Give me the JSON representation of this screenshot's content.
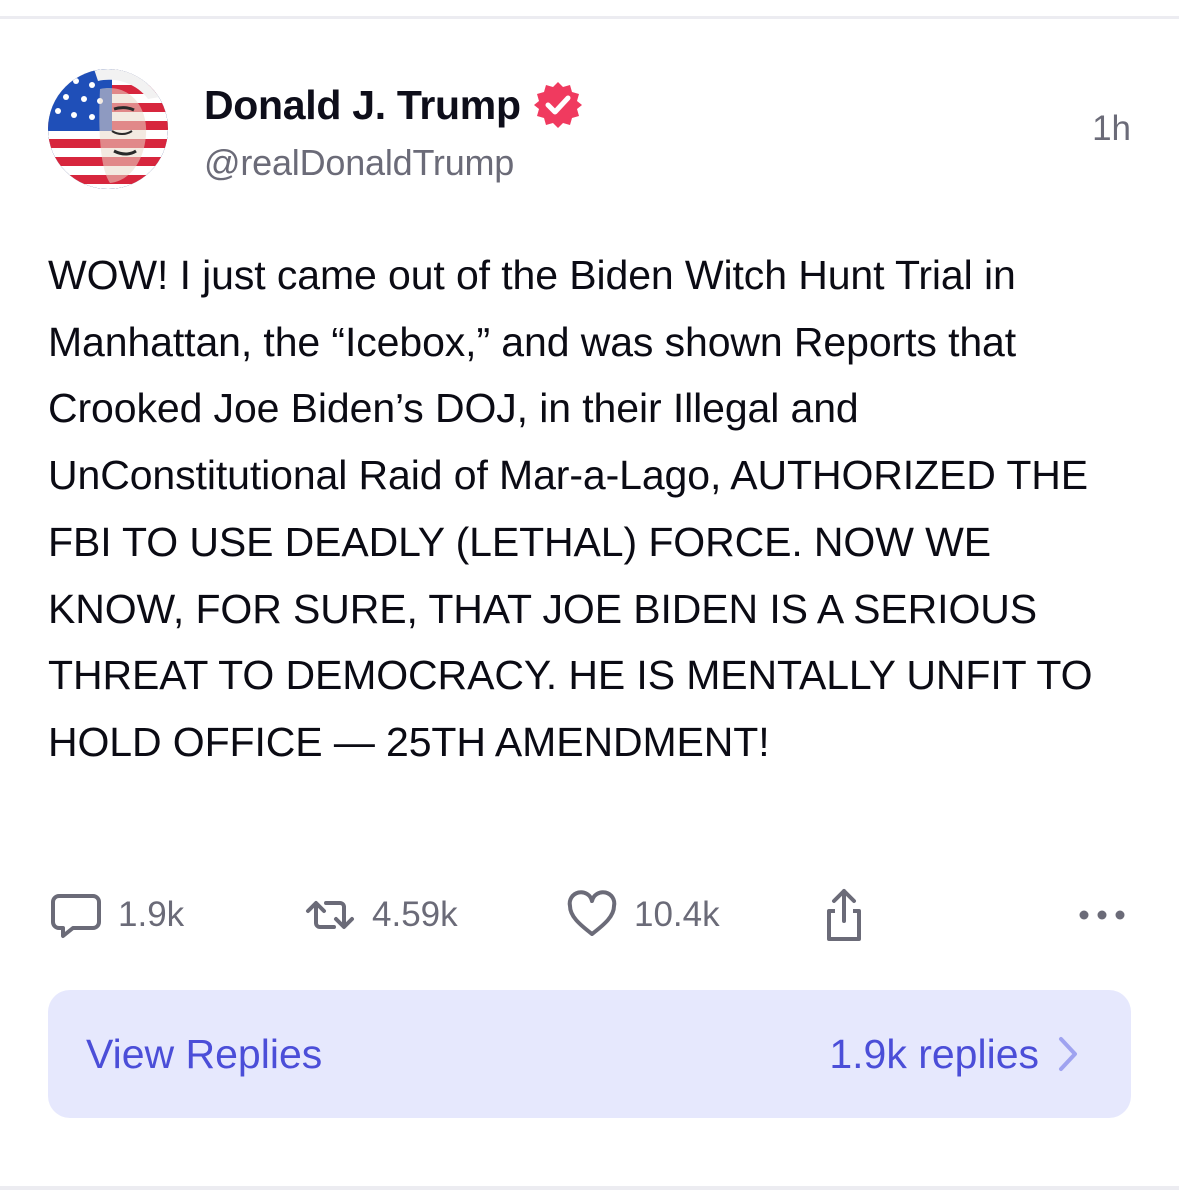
{
  "post": {
    "author": {
      "display_name": "Donald J. Trump",
      "handle": "@realDonaldTrump",
      "verified": true,
      "verified_color": "#f03a5f",
      "avatar_icon": "avatar-image"
    },
    "timestamp": "1h",
    "body": "WOW! I just came out of the Biden Witch Hunt Trial in Manhattan, the “Icebox,” and was shown Reports that Crooked Joe Biden’s DOJ, in their Illegal and UnConstitutional Raid of Mar-a-Lago, AUTHORIZED THE FBI TO USE DEADLY (LETHAL) FORCE. NOW WE KNOW, FOR SURE, THAT JOE BIDEN IS A SERIOUS THREAT TO DEMOCRACY. HE IS MENTALLY UNFIT TO HOLD OFFICE — 25TH AMENDMENT!"
  },
  "actions": {
    "replies": {
      "icon": "comment-icon",
      "count": "1.9k"
    },
    "retruths": {
      "icon": "repost-icon",
      "count": "4.59k"
    },
    "likes": {
      "icon": "heart-icon",
      "count": "10.4k"
    },
    "share": {
      "icon": "share-icon"
    },
    "more": {
      "icon": "more-icon"
    }
  },
  "replies_bar": {
    "label": "View Replies",
    "count_label": "1.9k replies",
    "icon": "chevron-right-icon"
  },
  "colors": {
    "accent": "#4b4ed8",
    "replies_bar_bg": "#e6e8fd",
    "muted_text": "#6b6b78"
  }
}
